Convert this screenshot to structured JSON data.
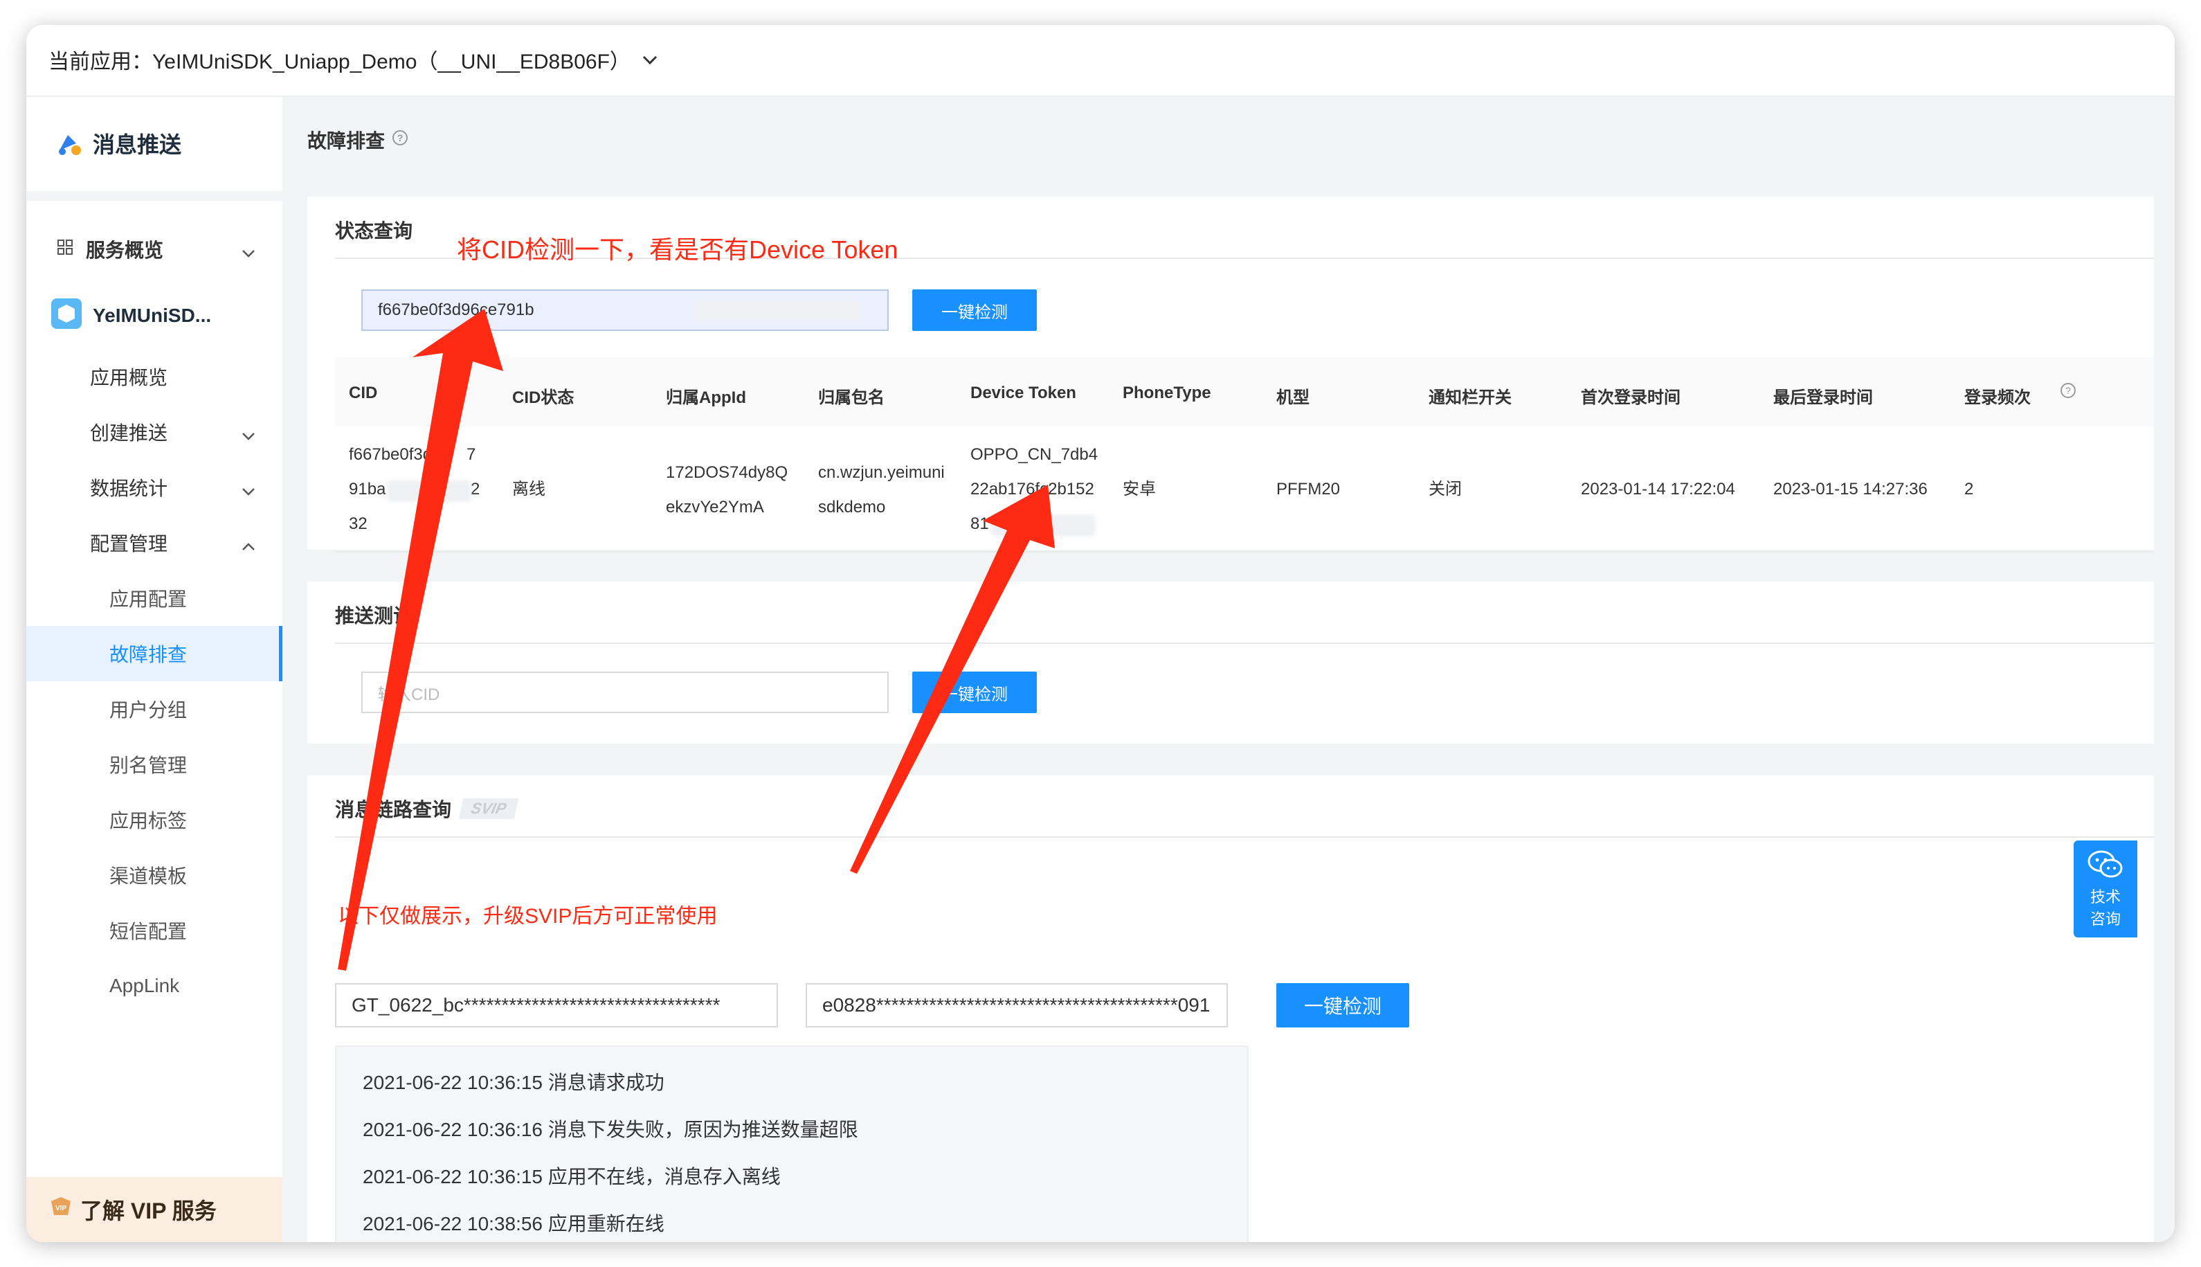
{
  "topbar": {
    "app_selector": "当前应用：YeIMUniSDK_Uniapp_Demo（__UNI__ED8B06F）"
  },
  "sidebar": {
    "brand": "消息推送",
    "service_overview": "服务概览",
    "app_name": "YeIMUniSD...",
    "items": [
      {
        "label": "应用概览"
      },
      {
        "label": "创建推送"
      },
      {
        "label": "数据统计"
      },
      {
        "label": "配置管理"
      },
      {
        "label": "应用配置"
      },
      {
        "label": "故障排查"
      },
      {
        "label": "用户分组"
      },
      {
        "label": "别名管理"
      },
      {
        "label": "应用标签"
      },
      {
        "label": "渠道模板"
      },
      {
        "label": "短信配置"
      },
      {
        "label": "AppLink"
      }
    ],
    "vip": "了解 VIP 服务"
  },
  "page": {
    "title": "故障排查"
  },
  "status_query": {
    "title": "状态查询",
    "cid_value": "f667be0f3d96ce791b",
    "button": "一键检测",
    "columns": [
      "CID",
      "CID状态",
      "归属AppId",
      "归属包名",
      "Device Token",
      "PhoneType",
      "机型",
      "通知栏开关",
      "首次登录时间",
      "最后登录时间",
      "登录频次"
    ],
    "row": {
      "cid_1": "f667be0f3d",
      "cid_1b": "7",
      "cid_2": "91ba",
      "cid_2b": "2",
      "cid_3": "32",
      "status": "离线",
      "appid_1": "172DOS74dy8Q",
      "appid_2": "ekzvYe2YmA",
      "pkg_1": "cn.wzjun.yeimuni",
      "pkg_2": "sdkdemo",
      "token_1": "OPPO_CN_7db4",
      "token_2": "22ab176fc2b152",
      "token_3": "81",
      "phone_type": "安卓",
      "model": "PFFM20",
      "notify": "关闭",
      "first_login": "2023-01-14 17:22:04",
      "last_login": "2023-01-15 14:27:36",
      "frequency": "2"
    }
  },
  "push_test": {
    "title": "推送测试",
    "placeholder": "输入CID",
    "button": "一键检测"
  },
  "link_query": {
    "title": "消息链路查询",
    "badge": "SVIP",
    "cid_value": "GT_0622_bc**********************************",
    "token_value": "e0828****************************************091",
    "button": "一键检测",
    "logs": [
      "2021-06-22 10:36:15 消息请求成功",
      "2021-06-22 10:36:16 消息下发失败，原因为推送数量超限",
      "2021-06-22 10:36:15 应用不在线，消息存入离线",
      "2021-06-22 10:38:56 应用重新在线"
    ]
  },
  "annotations": {
    "top": "将CID检测一下，看是否有Device Token",
    "bottom": "以下仅做展示，升级SVIP后方可正常使用"
  },
  "float_help": {
    "line1": "技术",
    "line2": "咨询"
  },
  "colors": {
    "primary": "#1890ff",
    "annotation": "#ff2a14",
    "vip_bg": "#fbeee0"
  }
}
